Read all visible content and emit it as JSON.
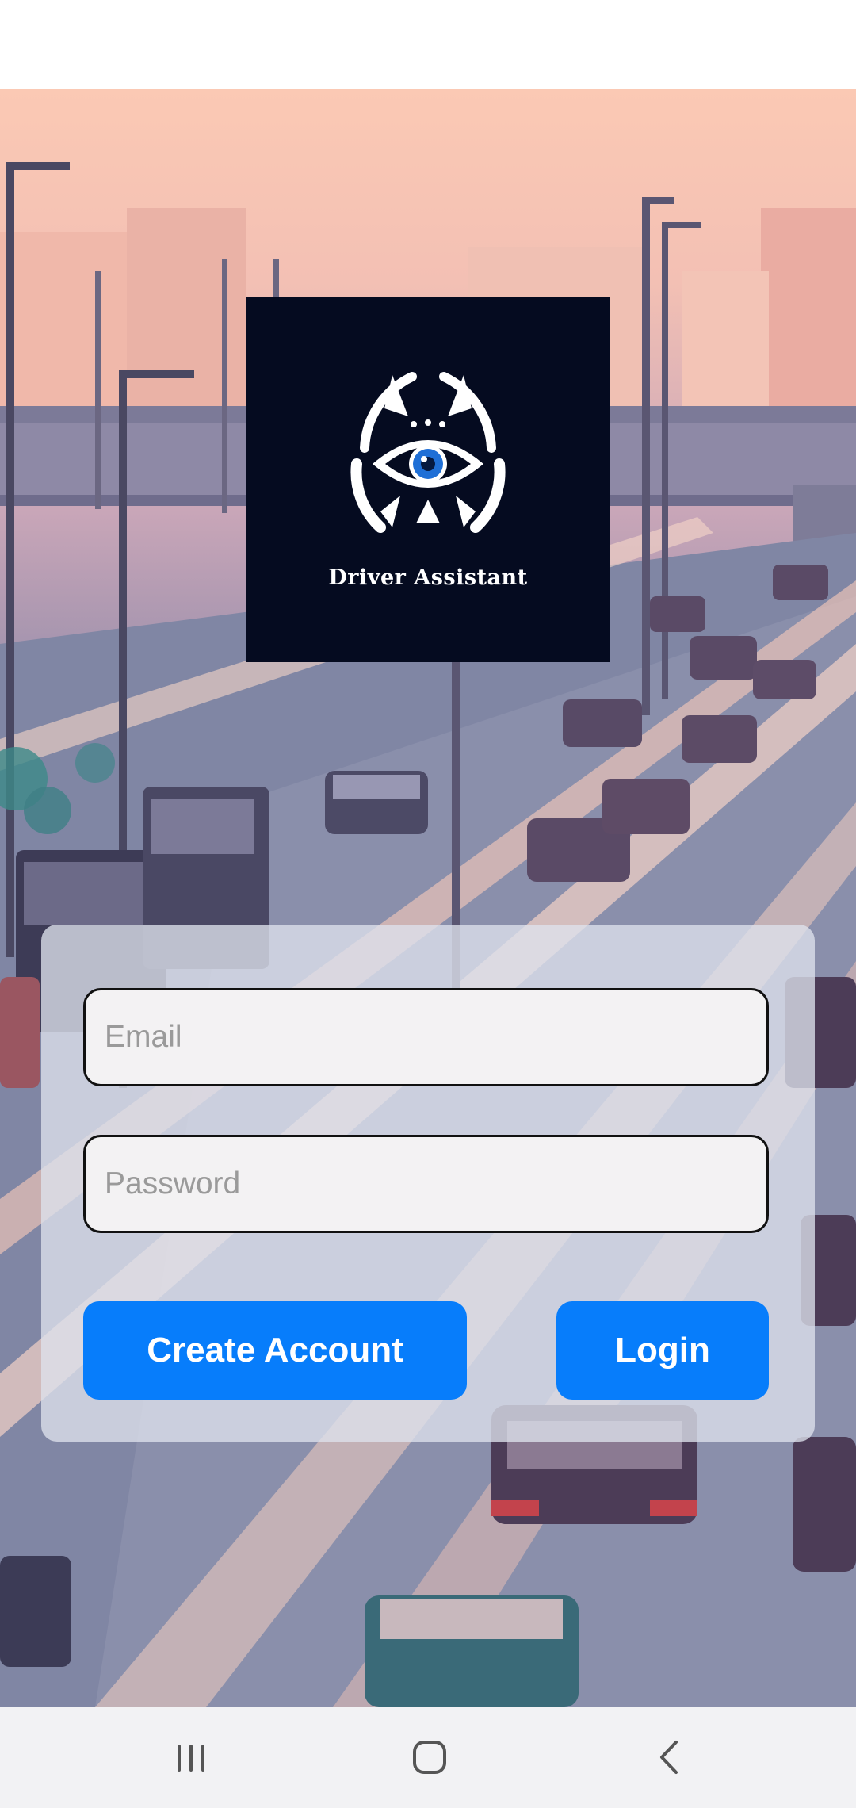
{
  "app": {
    "logo_text": "Driver Assistant"
  },
  "form": {
    "email_placeholder": "Email",
    "password_placeholder": "Password",
    "create_account_label": "Create Account",
    "login_label": "Login"
  },
  "colors": {
    "accent": "#077dfb",
    "logo_background": "#050b20",
    "iris": "#1f6fd6"
  },
  "icons": {
    "logo": "eye-emblem-icon",
    "nav_recents": "recents-icon",
    "nav_home": "home-icon",
    "nav_back": "back-icon"
  }
}
